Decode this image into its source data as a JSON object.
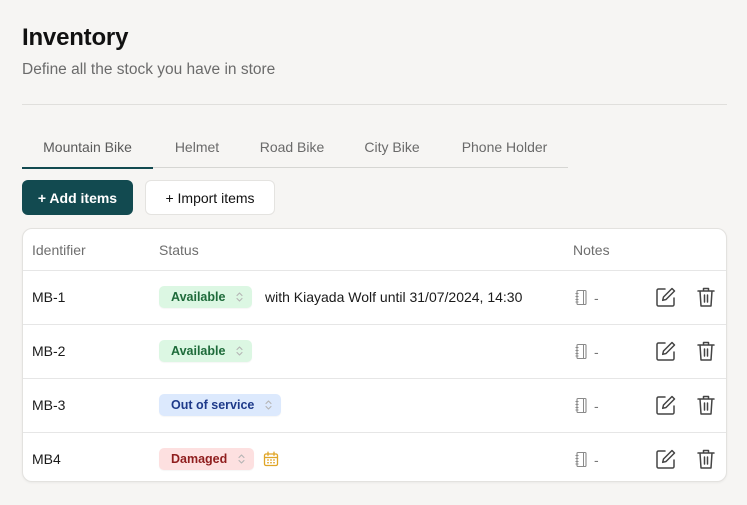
{
  "header": {
    "title": "Inventory",
    "subtitle": "Define all the stock you have in store"
  },
  "tabs": [
    {
      "label": "Mountain Bike",
      "active": true
    },
    {
      "label": "Helmet",
      "active": false
    },
    {
      "label": "Road Bike",
      "active": false
    },
    {
      "label": "City Bike",
      "active": false
    },
    {
      "label": "Phone Holder",
      "active": false
    }
  ],
  "toolbar": {
    "add_label": "+ Add items",
    "import_label": "+ Import items"
  },
  "table": {
    "columns": {
      "identifier": "Identifier",
      "status": "Status",
      "notes": "Notes"
    },
    "rows": [
      {
        "identifier": "MB-1",
        "status": "Available",
        "status_kind": "available",
        "status_note": "with Kiayada Wolf until 31/07/2024, 14:30",
        "notes": "-",
        "icons": [
          "notebook-icon",
          "edit-icon",
          "trash-icon"
        ]
      },
      {
        "identifier": "MB-2",
        "status": "Available",
        "status_kind": "available",
        "status_note": "",
        "notes": "-",
        "icons": [
          "notebook-icon",
          "edit-icon",
          "trash-icon"
        ]
      },
      {
        "identifier": "MB-3",
        "status": "Out of service",
        "status_kind": "out",
        "status_note": "",
        "notes": "-",
        "icons": [
          "notebook-icon",
          "edit-icon",
          "trash-icon"
        ]
      },
      {
        "identifier": "MB4",
        "status": "Damaged",
        "status_kind": "damaged",
        "status_note": "",
        "status_icon": "calendar-icon",
        "notes": "-",
        "icons": [
          "notebook-icon",
          "edit-icon",
          "trash-icon"
        ]
      }
    ]
  },
  "colors": {
    "primary": "#124a50",
    "available_bg": "#dcf7e3",
    "available_text": "#1e6b3a",
    "out_bg": "#dce9fd",
    "out_text": "#1e3a8a",
    "damaged_bg": "#fde0e0",
    "damaged_text": "#8f1d1d",
    "calendar": "#e0a526"
  }
}
